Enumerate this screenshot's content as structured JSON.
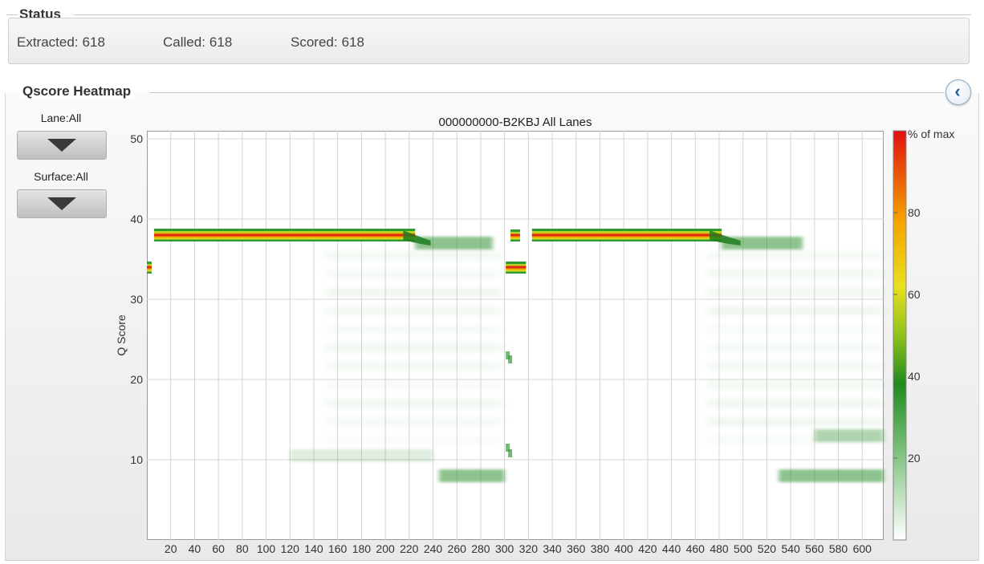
{
  "status": {
    "title": "Status",
    "items": [
      {
        "label": "Extracted:",
        "value": "618"
      },
      {
        "label": "Called:",
        "value": "618"
      },
      {
        "label": "Scored:",
        "value": "618"
      }
    ]
  },
  "heatmap_panel": {
    "title": "Qscore Heatmap",
    "collapse_icon": "chevron-left-icon",
    "lane_label": "Lane:All",
    "surface_label": "Surface:All"
  },
  "chart_data": {
    "type": "heatmap",
    "title": "000000000-B2KBJ All Lanes",
    "xlabel": "",
    "ylabel": "Q Score",
    "xlim": [
      0,
      618
    ],
    "ylim": [
      0,
      51
    ],
    "x_ticks": [
      20,
      40,
      60,
      80,
      100,
      120,
      140,
      160,
      180,
      200,
      220,
      240,
      260,
      280,
      300,
      320,
      340,
      360,
      380,
      400,
      420,
      440,
      460,
      480,
      500,
      520,
      540,
      560,
      580,
      600
    ],
    "y_ticks": [
      10,
      20,
      30,
      40,
      50
    ],
    "colorbar": {
      "label": "% of max",
      "ticks": [
        20,
        40,
        60,
        80
      ],
      "range": [
        0,
        100
      ]
    },
    "grid": true,
    "features": [
      {
        "x": [
          6,
          225
        ],
        "q": 38,
        "intensity": 100
      },
      {
        "x": [
          225,
          290
        ],
        "q": 37,
        "intensity": 45
      },
      {
        "x": [
          0,
          4
        ],
        "q": 34,
        "intensity": 100
      },
      {
        "x": [
          301,
          318
        ],
        "q": 34,
        "intensity": 100
      },
      {
        "x": [
          305,
          313
        ],
        "q": 38,
        "intensity": 100
      },
      {
        "x": [
          323,
          482
        ],
        "q": 38,
        "intensity": 100
      },
      {
        "x": [
          482,
          550
        ],
        "q": 37,
        "intensity": 45
      },
      {
        "x": [
          245,
          300
        ],
        "q": 8,
        "intensity": 45
      },
      {
        "x": [
          530,
          618
        ],
        "q": 8,
        "intensity": 45
      },
      {
        "x": [
          560,
          618
        ],
        "q": 13,
        "intensity": 30
      },
      {
        "x": [
          120,
          240
        ],
        "q": 10.5,
        "intensity": 12
      }
    ]
  }
}
